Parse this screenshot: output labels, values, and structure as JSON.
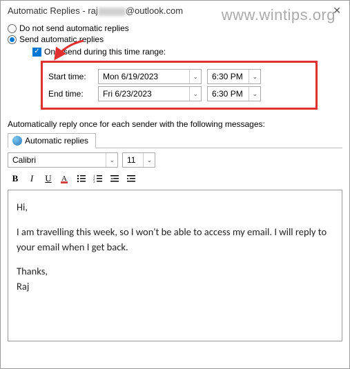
{
  "watermark": "www.wintips.org",
  "title_prefix": "Automatic Replies - raj",
  "title_suffix": "@outlook.com",
  "radios": {
    "no_auto": "Do not send automatic replies",
    "send_auto": "Send automatic replies"
  },
  "checkbox_label": "Only send during this time range:",
  "time_range": {
    "start_label": "Start time:",
    "start_date": "Mon 6/19/2023",
    "start_time": "6:30 PM",
    "end_label": "End time:",
    "end_date": "Fri 6/23/2023",
    "end_time": "6:30 PM"
  },
  "instruction": "Automatically reply once for each sender with the following messages:",
  "tab_label": "Automatic replies",
  "font_name": "Calibri",
  "font_size": "11",
  "format_buttons": {
    "bold": "B",
    "italic": "I",
    "underline": "U",
    "font_color": "A"
  },
  "message": {
    "greeting": "Hi,",
    "body": "I am travelling this week, so I won't be able to access my email. I will reply to your email when I get back.",
    "closing": "Thanks,",
    "signature": "Raj"
  }
}
